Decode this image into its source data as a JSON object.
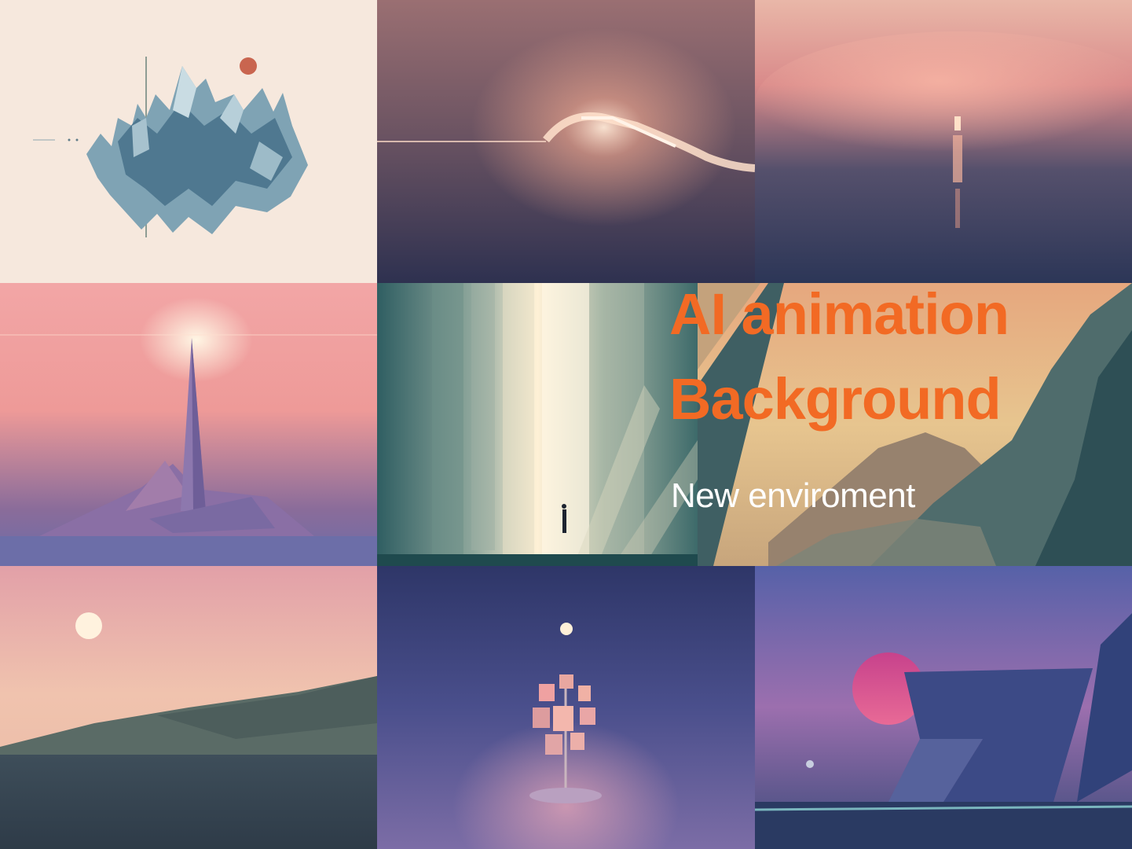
{
  "headline": {
    "line1": "AI animation",
    "line2": "Background",
    "color": "#F26A24"
  },
  "subtitle": {
    "text": "New enviroment",
    "color": "#FFFFFF"
  },
  "gallery": {
    "tiles": [
      "polygonal-mountain-art",
      "glowing-horizon-art",
      "lighthouse-reflection-art",
      "obelisk-island-art",
      "light-corridor-art",
      "coastal-cliffs-art",
      "moon-over-hills-art",
      "tree-of-frames-art",
      "geometric-sunset-art"
    ]
  }
}
